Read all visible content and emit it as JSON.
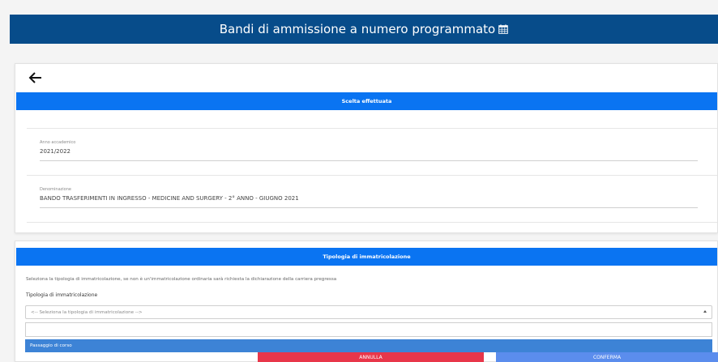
{
  "header": {
    "title": "Bandi di ammissione a numero programmato"
  },
  "selection": {
    "heading": "Scelta effettuata",
    "fields": [
      {
        "label": "Anno accademico",
        "value": "2021/2022"
      },
      {
        "label": "Denominazione",
        "value": "BANDO TRASFERIMENTI IN INGRESSO - MEDICINE AND SURGERY - 2° ANNO - GIUGNO 2021"
      }
    ]
  },
  "enrollment": {
    "heading": "Tipologia di immatricolazione",
    "help": "Seleziona la tipologia di immatricolazione, se non è un'immatricolazione ordinaria sarà richiesta la dichiarazione della carriera pregressa",
    "select_label": "Tipologia di immatricolazione",
    "select_placeholder": "<-- Seleziona la tipologia di immatricolazione -->",
    "options": [
      "Passaggio di corso"
    ]
  },
  "buttons": {
    "cancel": "ANNULLA",
    "confirm": "CONFERMA"
  },
  "colors": {
    "header": "#074c8a",
    "section_bar": "#0a74f2",
    "option_highlight": "#3d83d6",
    "cancel": "#e8364a",
    "confirm": "#5b8ded"
  },
  "icons": {
    "back": "arrow-left-icon",
    "calendar": "calendar-icon"
  }
}
